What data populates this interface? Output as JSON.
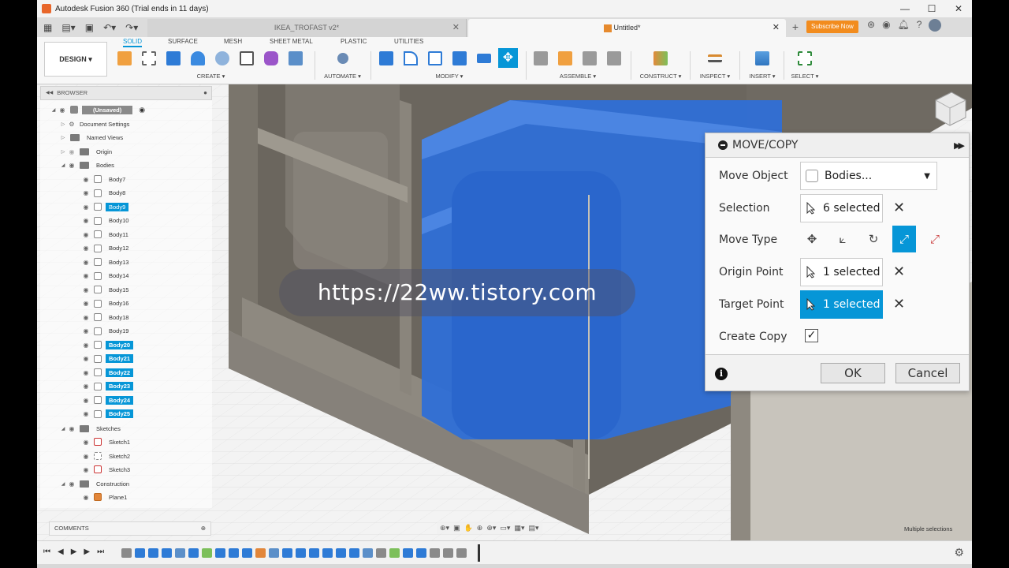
{
  "window": {
    "title": "Autodesk Fusion 360 (Trial ends in 11 days)",
    "controls": [
      "—",
      "☐",
      "✕"
    ]
  },
  "tabs": {
    "doc1": "IKEA_TROFAST v2*",
    "doc2": "Untitled*",
    "close": "✕",
    "plus": "+",
    "subscribe": "Subscribe Now"
  },
  "toolbar": {
    "design": "DESIGN ▾",
    "ribbon_tabs": [
      "SOLID",
      "SURFACE",
      "MESH",
      "SHEET METAL",
      "PLASTIC",
      "UTILITIES"
    ],
    "groups": {
      "create": "CREATE ▾",
      "automate": "AUTOMATE ▾",
      "modify": "MODIFY ▾",
      "assemble": "ASSEMBLE ▾",
      "construct": "CONSTRUCT ▾",
      "inspect": "INSPECT ▾",
      "insert": "INSERT ▾",
      "select": "SELECT ▾"
    }
  },
  "browser": {
    "title": "BROWSER",
    "root": "(Unsaved)",
    "document_settings": "Document Settings",
    "named_views": "Named Views",
    "origin": "Origin",
    "bodies": "Bodies",
    "body_items": [
      {
        "label": "Body7",
        "selected": false
      },
      {
        "label": "Body8",
        "selected": false
      },
      {
        "label": "Body9",
        "selected": true
      },
      {
        "label": "Body10",
        "selected": false
      },
      {
        "label": "Body11",
        "selected": false
      },
      {
        "label": "Body12",
        "selected": false
      },
      {
        "label": "Body13",
        "selected": false
      },
      {
        "label": "Body14",
        "selected": false
      },
      {
        "label": "Body15",
        "selected": false
      },
      {
        "label": "Body16",
        "selected": false
      },
      {
        "label": "Body18",
        "selected": false
      },
      {
        "label": "Body19",
        "selected": false
      },
      {
        "label": "Body20",
        "selected": true
      },
      {
        "label": "Body21",
        "selected": true
      },
      {
        "label": "Body22",
        "selected": true
      },
      {
        "label": "Body23",
        "selected": true
      },
      {
        "label": "Body24",
        "selected": true
      },
      {
        "label": "Body25",
        "selected": true
      }
    ],
    "sketches": "Sketches",
    "sketch_items": [
      "Sketch1",
      "Sketch2",
      "Sketch3"
    ],
    "construction": "Construction",
    "construction_items": [
      "Plane1"
    ]
  },
  "comments": "COMMENTS",
  "status": "Multiple selections",
  "watermark": "https://22ww.tistory.com",
  "dialog": {
    "title": "MOVE/COPY",
    "move_object_label": "Move Object",
    "move_object_value": "Bodies...",
    "selection_label": "Selection",
    "selection_value": "6 selected",
    "move_type_label": "Move Type",
    "origin_point_label": "Origin Point",
    "origin_point_value": "1 selected",
    "target_point_label": "Target Point",
    "target_point_value": "1 selected",
    "create_copy_label": "Create Copy",
    "create_copy_checked": "✓",
    "ok": "OK",
    "cancel": "Cancel"
  },
  "colors": {
    "accent": "#0696d7",
    "selection_blue": "#2f6fd6",
    "subscribe": "#f28c1e"
  }
}
